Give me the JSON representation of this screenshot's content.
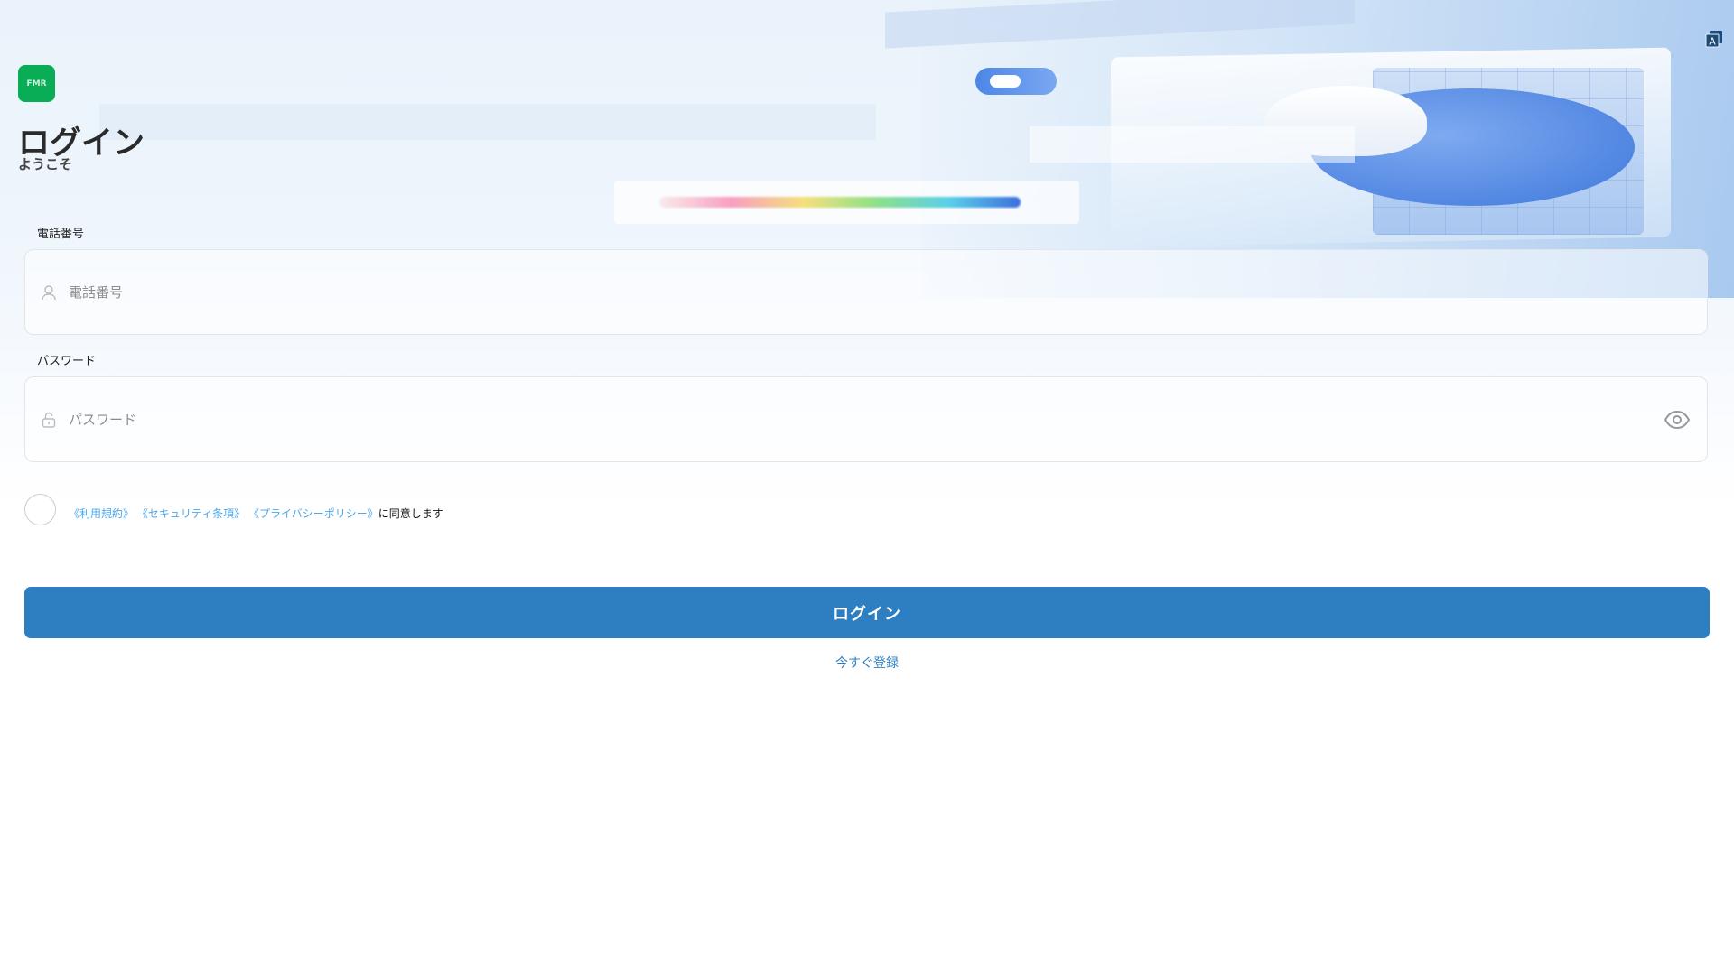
{
  "logo": {
    "text": "FMR",
    "color": "#08ad56"
  },
  "header": {
    "title": "ログイン",
    "subtitle": "ようこそ"
  },
  "phone": {
    "label": "電話番号",
    "placeholder": "電話番号",
    "value": "",
    "icon": "user-icon"
  },
  "password": {
    "label": "パスワード",
    "placeholder": "パスワード",
    "value": "",
    "icon": "lock-open-icon",
    "toggle_icon": "eye-icon"
  },
  "terms": {
    "checked": false,
    "links": [
      "《利用規約》",
      "《セキュリティ条項》",
      "《プライバシーポリシー》"
    ],
    "suffix": "に同意します"
  },
  "login_button": {
    "label": "ログイン",
    "color": "#2e7fc2"
  },
  "register_link": {
    "label": "今すぐ登録"
  },
  "translate_icon": "translate-icon"
}
